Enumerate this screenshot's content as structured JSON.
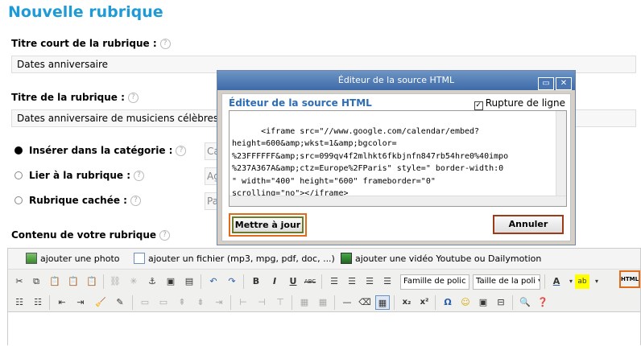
{
  "page": {
    "title": "Nouvelle rubrique"
  },
  "short_title": {
    "label": "Titre court de la rubrique :",
    "value": "Dates anniversaire"
  },
  "title_field": {
    "label": "Titre de la rubrique :",
    "value": "Dates anniversaire de musiciens célèbres"
  },
  "placement": {
    "insert_label": "Insérer dans la catégorie :",
    "insert_value": "Ca",
    "link_label": "Lier à la rubrique :",
    "link_placeholder": "Ag",
    "hidden_label": "Rubrique cachée :",
    "hidden_placeholder": "Pa",
    "selected": "insert"
  },
  "content": {
    "label": "Contenu de votre rubrique"
  },
  "help_glyph": "?",
  "media_bar": {
    "photo": "ajouter une photo",
    "file": "ajouter un fichier (mp3, mpg, pdf, doc, ...)",
    "video": "ajouter une vidéo Youtube ou Dailymotion"
  },
  "toolbar": {
    "font_family": "Famille de polic",
    "font_size": "Taille de la poli",
    "html_button": "HTML",
    "bold": "B",
    "italic": "I",
    "underline": "U",
    "strike": "ABC",
    "subscript": "x₂",
    "superscript": "x²",
    "omega": "Ω"
  },
  "dialog": {
    "title": "Éditeur de la source HTML",
    "heading": "Éditeur de la source HTML",
    "wrap_label": "Rupture de ligne",
    "wrap_checked": true,
    "source": "<iframe src=\"//www.google.com/calendar/embed?\nheight=600&amp;wkst=1&amp;bgcolor=\n%23FFFFFF&amp;src=099qv4f2mlhkt6fkbjnfn847rb54hre0%40impo\n%237A367A&amp;ctz=Europe%2FParis\" style=\" border-width:0\n\" width=\"400\" height=\"600\" frameborder=\"0\"\nscrolling=\"no\"></iframe>",
    "update_button": "Mettre à jour",
    "cancel_button": "Annuler",
    "minimize": "▭",
    "close": "✕"
  },
  "colors": {
    "title": "#1e9bd7",
    "highlight": "#e06b1b",
    "dialog_header": "#2d6db5"
  }
}
